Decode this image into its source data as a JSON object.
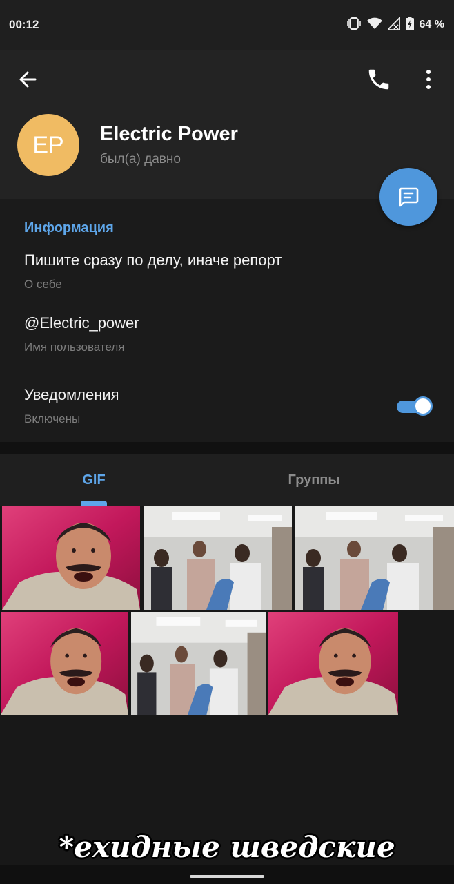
{
  "status_bar": {
    "time": "00:12",
    "battery": "64 %",
    "icons": [
      "vibrate-icon",
      "wifi-icon",
      "signal-icon",
      "battery-charging-icon"
    ]
  },
  "header": {
    "back_icon": "arrow-left-icon",
    "call_icon": "phone-icon",
    "menu_icon": "more-vertical-icon",
    "avatar_initials": "EP",
    "avatar_color": "#f0bb63",
    "name": "Electric Power",
    "last_seen": "был(а) давно"
  },
  "fab": {
    "icon": "message-icon",
    "color": "#4f97dc"
  },
  "info": {
    "title": "Информация",
    "bio": "Пишите сразу по делу, иначе репорт",
    "bio_label": "О себе",
    "username": "@Electric_power",
    "username_label": "Имя пользователя",
    "notifications": "Уведомления",
    "notifications_state": "Включены",
    "notifications_enabled": true
  },
  "tabs": [
    {
      "label": "GIF",
      "active": true
    },
    {
      "label": "Группы",
      "active": false
    }
  ],
  "media": {
    "items": [
      "gif-laughing-man",
      "gif-office-group",
      "gif-office-group",
      "gif-laughing-man",
      "gif-office-group",
      "gif-laughing-man"
    ]
  },
  "caption": "*ехидные шведские звуки*",
  "colors": {
    "accent": "#5ea6ea",
    "background": "#181818"
  }
}
